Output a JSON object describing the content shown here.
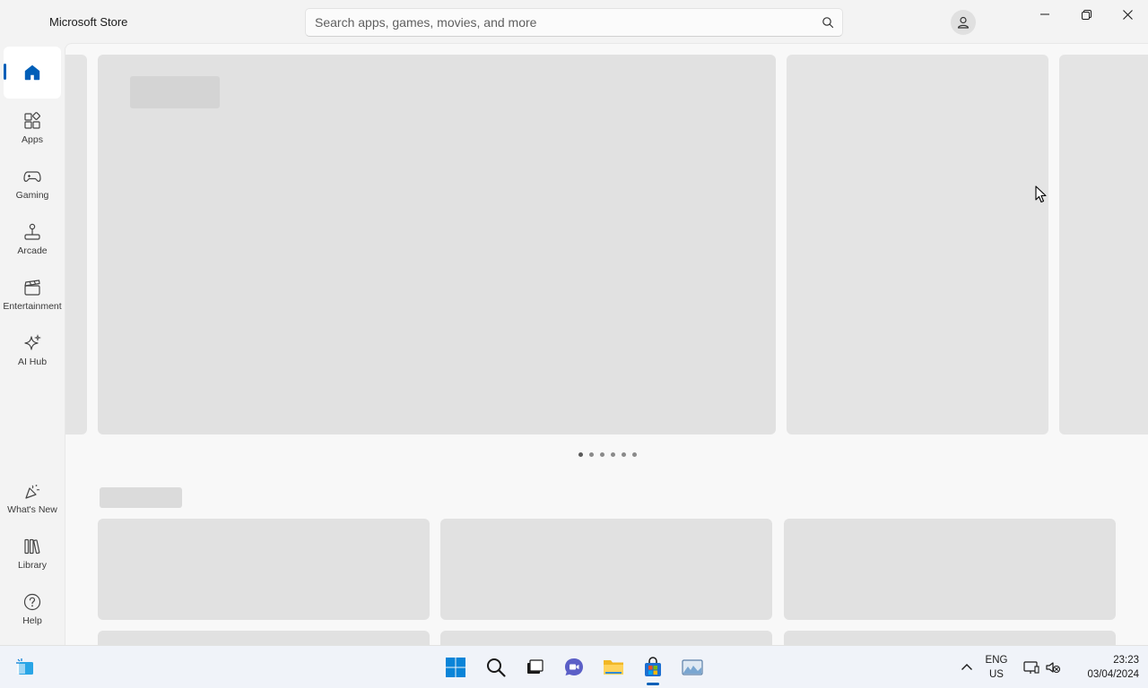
{
  "app": {
    "title": "Microsoft Store"
  },
  "search": {
    "placeholder": "Search apps, games, movies, and more"
  },
  "sidebar": {
    "items": [
      {
        "label": "",
        "icon": "home-icon",
        "active": true
      },
      {
        "label": "Apps",
        "icon": "apps-icon"
      },
      {
        "label": "Gaming",
        "icon": "gamepad-icon"
      },
      {
        "label": "Arcade",
        "icon": "joystick-icon"
      },
      {
        "label": "Entertainment",
        "icon": "clapperboard-icon"
      },
      {
        "label": "AI Hub",
        "icon": "sparkle-icon"
      }
    ],
    "bottom_items": [
      {
        "label": "What's New",
        "icon": "party-popper-icon"
      },
      {
        "label": "Library",
        "icon": "library-icon"
      },
      {
        "label": "Help",
        "icon": "help-icon"
      }
    ]
  },
  "hero": {
    "dot_count": 6,
    "active_dot": 0
  },
  "taskbar": {
    "language": "ENG",
    "region": "US",
    "time": "23:23",
    "date": "03/04/2024"
  },
  "colors": {
    "accent": "#005fb8",
    "placeholder": "#e1e1e1",
    "background": "#f3f3f3"
  }
}
